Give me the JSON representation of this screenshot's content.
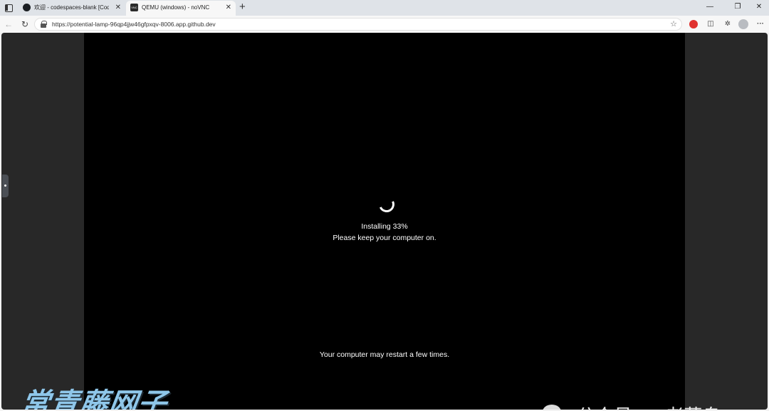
{
  "browser": {
    "tabs": [
      {
        "title": "欢迎 - codespaces-blank [Codesp",
        "favicon": "github-icon",
        "active": false
      },
      {
        "title": "QEMU (windows) - noVNC",
        "favicon": "novnc-icon",
        "active": true
      }
    ],
    "url": "https://potential-lamp-96qp4jjw46gfpxqv-8006.app.github.dev",
    "new_tab_symbol": "+",
    "close_symbol": "✕"
  },
  "vnc": {
    "install_status": "Installing  33%",
    "install_message": "Please keep your computer on.",
    "restart_message": "Your computer may restart a few times."
  },
  "progress": {
    "percent": 33
  },
  "watermarks": {
    "left": "常青藤网子",
    "right": "公众号 · IT老菜鸟"
  },
  "colors": {
    "vnc_background": "#000000",
    "page_background": "#282828",
    "watermark_left": "#8fc7ea"
  }
}
